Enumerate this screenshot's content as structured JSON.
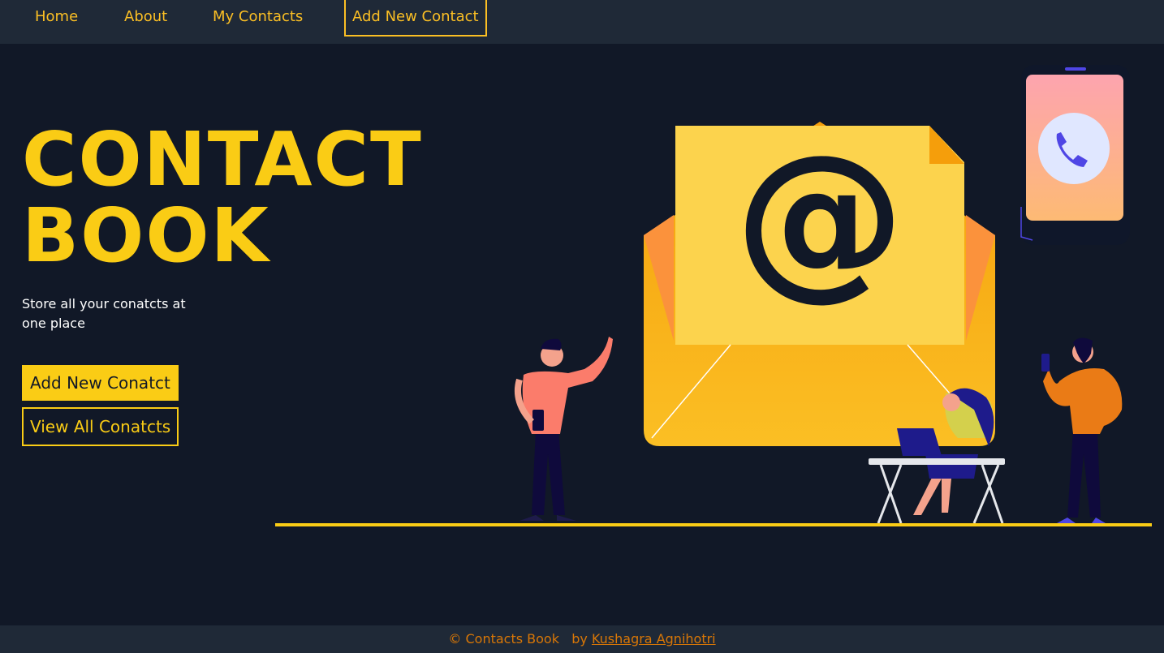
{
  "nav": {
    "home": "Home",
    "about": "About",
    "my_contacts": "My Contacts",
    "add_new_contact": "Add New Contact"
  },
  "hero": {
    "title_line1": "CONTACT",
    "title_line2": "BOOK",
    "tagline": "Store all your conatcts at one place",
    "primary_button": "Add New Conatct",
    "secondary_button": "View All Conatcts"
  },
  "illustration": {
    "at_symbol": "@"
  },
  "footer": {
    "copyright": "© Contacts Book",
    "by": "by",
    "author": "Kushagra Agnihotri"
  },
  "colors": {
    "background": "#111827",
    "navbar": "#1f2937",
    "accent": "#facc15",
    "footer_text": "#d97706"
  }
}
